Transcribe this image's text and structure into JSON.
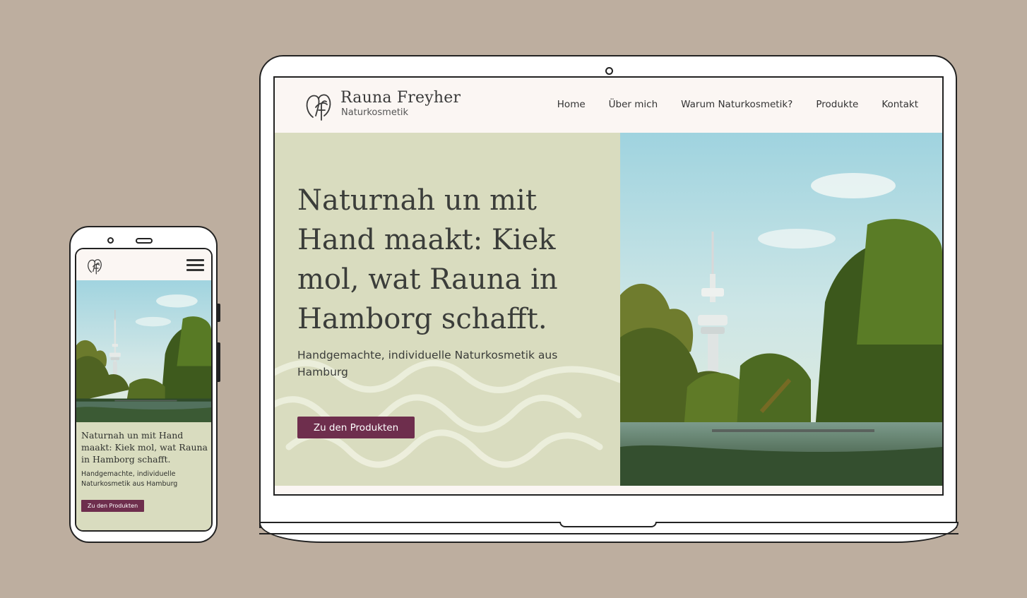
{
  "colors": {
    "background": "#bdae9f",
    "header_bg": "#fbf6f3",
    "hero_bg": "#d9dcbf",
    "accent": "#6e2e4d",
    "text": "#3b3d3a"
  },
  "desktop": {
    "brand": {
      "name": "Rauna Freyher",
      "subtitle": "Naturkosmetik",
      "logo_icon": "rf-monogram-icon"
    },
    "nav": [
      {
        "label": "Home"
      },
      {
        "label": "Über mich"
      },
      {
        "label": "Warum Naturkosmetik?"
      },
      {
        "label": "Produkte"
      },
      {
        "label": "Kontakt"
      }
    ],
    "hero": {
      "title": "Naturnah un mit Hand maakt: Kiek mol, wat Rauna in Hamborg schafft.",
      "subtitle": "Handgemachte, individuelle Naturkosmetik aus Hamburg",
      "cta_label": "Zu den Produkten",
      "image": "hamburg-tv-tower-park-photo"
    }
  },
  "mobile": {
    "logo_icon": "rf-monogram-icon",
    "menu_icon": "hamburger-menu-icon",
    "hero": {
      "title": "Naturnah un mit Hand maakt: Kiek mol, wat Rauna in Hamborg schafft.",
      "subtitle": "Handgemachte, individuelle Naturkosmetik aus Hamburg",
      "cta_label": "Zu den Produkten",
      "image": "hamburg-tv-tower-park-photo"
    }
  }
}
